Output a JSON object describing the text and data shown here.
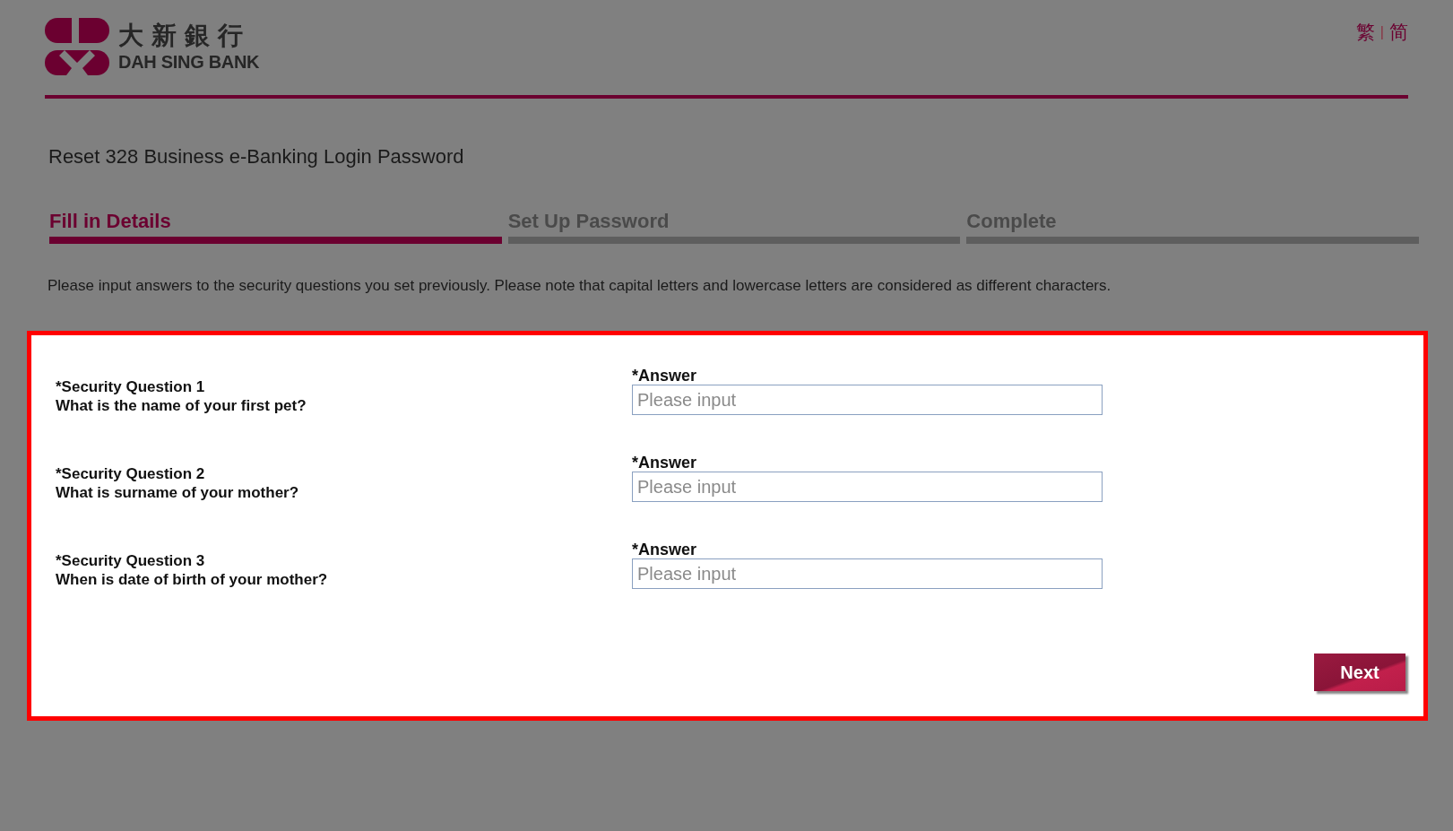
{
  "header": {
    "logo_chinese": "大新銀行",
    "logo_english": "DAH SING BANK",
    "languages": [
      {
        "label": "繁"
      },
      {
        "label": "简"
      }
    ],
    "language_separator": "|"
  },
  "title": "Reset 328 Business e-Banking Login Password",
  "steps": [
    {
      "label": "Fill in Details",
      "selected": true
    },
    {
      "label": "Set Up Password",
      "selected": false
    },
    {
      "label": "Complete",
      "selected": false
    }
  ],
  "instructions": "Please input answers to the security questions you set previously. Please note that capital letters and lowercase letters are considered as different characters.",
  "questions": [
    {
      "label": "*Security Question 1",
      "question": "What is the name of your first pet?",
      "answer_label": "*Answer",
      "placeholder": "Please input"
    },
    {
      "label": "*Security Question 2",
      "question": "What is surname of your mother?",
      "answer_label": "*Answer",
      "placeholder": "Please input"
    },
    {
      "label": "*Security Question 3",
      "question": "When is date of birth of your mother?",
      "answer_label": "*Answer",
      "placeholder": "Please input"
    }
  ],
  "next_button": "Next"
}
